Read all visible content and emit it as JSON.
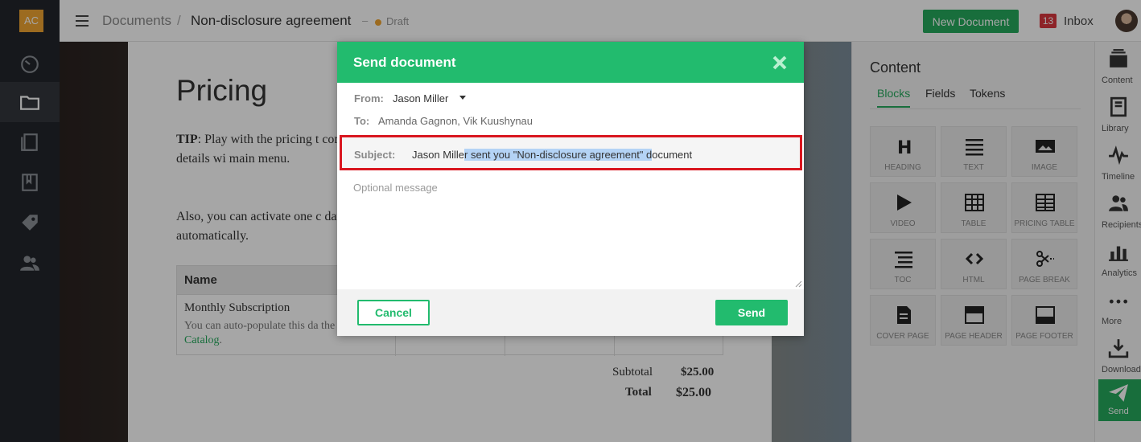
{
  "app": {
    "logo_initials": "AC"
  },
  "header": {
    "breadcrumb_root": "Documents",
    "breadcrumb_separator": "/",
    "document_name": "Non-disclosure agreement",
    "status_dash": "–",
    "status": "Draft",
    "new_document_label": "New Document",
    "inbox_count": "13",
    "inbox_label": "Inbox"
  },
  "sidebar": {
    "items": [
      {
        "icon": "dashboard-icon"
      },
      {
        "icon": "folder-icon",
        "active": true
      },
      {
        "icon": "documents-icon"
      },
      {
        "icon": "book-icon"
      },
      {
        "icon": "tag-icon"
      },
      {
        "icon": "contacts-icon"
      }
    ]
  },
  "document": {
    "title": "Pricing",
    "tip_bold": "TIP",
    "tip_text": ": Play with the pricing t complete pricing details wi main menu.",
    "also_text": "Also, you can activate one c data in automatically.",
    "table_header_name": "Name",
    "row_name": "Monthly Subscription",
    "row_desc": "You can auto-populate this da the ",
    "row_link": "Pricing Catalog",
    "row_desc_end": ".",
    "subtotal_label": "Subtotal",
    "subtotal_value": "$25.00",
    "total_label": "Total",
    "total_value": "$25.00"
  },
  "content_panel": {
    "title": "Content",
    "tabs": [
      "Blocks",
      "Fields",
      "Tokens"
    ],
    "blocks": [
      "HEADING",
      "TEXT",
      "IMAGE",
      "VIDEO",
      "TABLE",
      "PRICING TABLE",
      "TOC",
      "HTML",
      "PAGE BREAK",
      "COVER PAGE",
      "PAGE HEADER",
      "PAGE FOOTER"
    ]
  },
  "toolbar": {
    "items": [
      "Content",
      "Library",
      "Timeline",
      "Recipients",
      "Analytics",
      "More",
      "Download",
      "Send"
    ]
  },
  "modal": {
    "title": "Send document",
    "from_label": "From:",
    "from_value": "Jason Miller",
    "to_label": "To:",
    "to_value": "Amanda Gagnon, Vik Kuushynau",
    "subject_label": "Subject:",
    "subject_pre": "Jason Mille",
    "subject_selected": "r sent you \"Non-disclosure agreement\" d",
    "subject_post": "ocument",
    "message_placeholder": "Optional message",
    "cancel_label": "Cancel",
    "send_label": "Send"
  },
  "colors": {
    "accent": "#22bb6e",
    "header_green": "#25a95d",
    "highlight_border": "#d9161f",
    "selection": "#b4d3f5",
    "sidebar": "#23262b"
  }
}
